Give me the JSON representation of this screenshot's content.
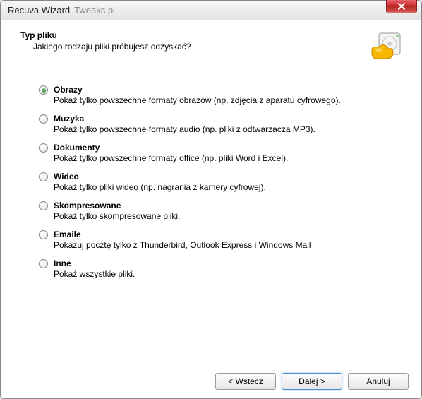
{
  "window": {
    "title": "Recuva Wizard",
    "title_extra": "Tweaks.pl"
  },
  "header": {
    "title": "Typ pliku",
    "subtitle": "Jakiego rodzaju pliki próbujesz odzyskać?"
  },
  "options": [
    {
      "label": "Obrazy",
      "desc": "Pokaż tylko powszechne formaty obrazów (np. zdjęcia z aparatu cyfrowego).",
      "selected": true
    },
    {
      "label": "Muzyka",
      "desc": "Pokaż tylko powszechne formaty audio (np. pliki z odtwarzacza MP3).",
      "selected": false
    },
    {
      "label": "Dokumenty",
      "desc": "Pokaż tylko powszechne formaty office (np. pliki Word i Excel).",
      "selected": false
    },
    {
      "label": "Wideo",
      "desc": "Pokaż tylko pliki wideo (np. nagrania z kamery cyfrowej).",
      "selected": false
    },
    {
      "label": "Skompresowane",
      "desc": "Pokaż tylko skompresowane pliki.",
      "selected": false
    },
    {
      "label": "Emaile",
      "desc": "Pokazuj pocztę tylko z Thunderbird, Outlook Express i Windows Mail",
      "selected": false
    },
    {
      "label": "Inne",
      "desc": "Pokaż wszystkie pliki.",
      "selected": false
    }
  ],
  "buttons": {
    "back": "< Wstecz",
    "next": "Dalej >",
    "cancel": "Anuluj"
  }
}
